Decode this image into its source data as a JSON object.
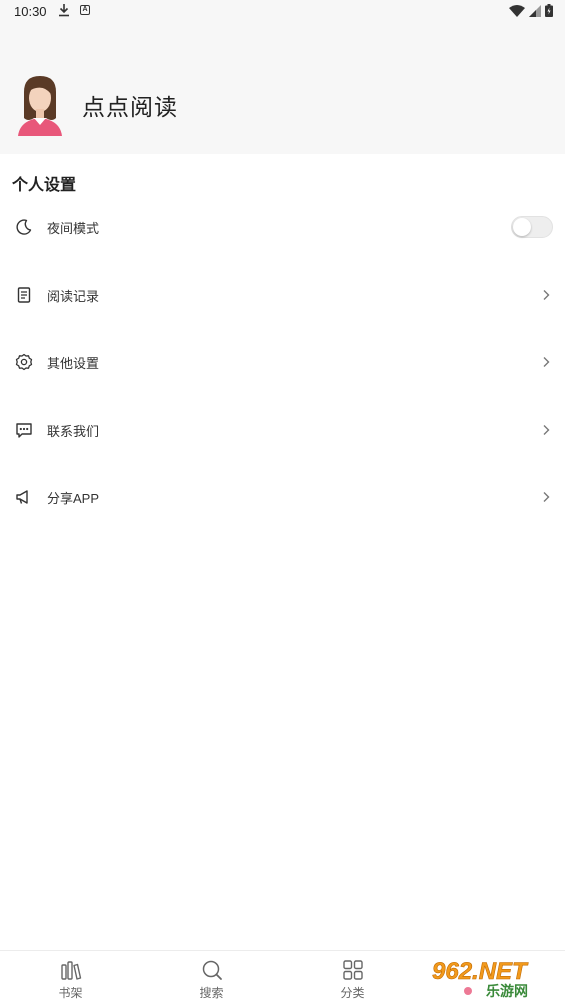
{
  "status": {
    "time": "10:30"
  },
  "profile": {
    "app_name": "点点阅读"
  },
  "settings": {
    "section_title": "个人设置",
    "items": [
      {
        "label": "夜间模式",
        "icon": "moon-icon",
        "control": "toggle",
        "toggle_on": false
      },
      {
        "label": "阅读记录",
        "icon": "document-icon",
        "control": "chevron"
      },
      {
        "label": "其他设置",
        "icon": "gear-icon",
        "control": "chevron"
      },
      {
        "label": "联系我们",
        "icon": "chat-icon",
        "control": "chevron"
      },
      {
        "label": "分享APP",
        "icon": "megaphone-icon",
        "control": "chevron"
      }
    ]
  },
  "tabbar": {
    "tabs": [
      {
        "label": "书架",
        "icon": "bookshelf-icon"
      },
      {
        "label": "搜索",
        "icon": "search-icon"
      },
      {
        "label": "分类",
        "icon": "grid-icon"
      }
    ]
  },
  "watermark": {
    "brand": "962.NET",
    "sub": "乐游网"
  },
  "colors": {
    "header_bg": "#f7f7f7",
    "toggle_off": "#eeeeee",
    "watermark_orange": "#f29a1c"
  }
}
